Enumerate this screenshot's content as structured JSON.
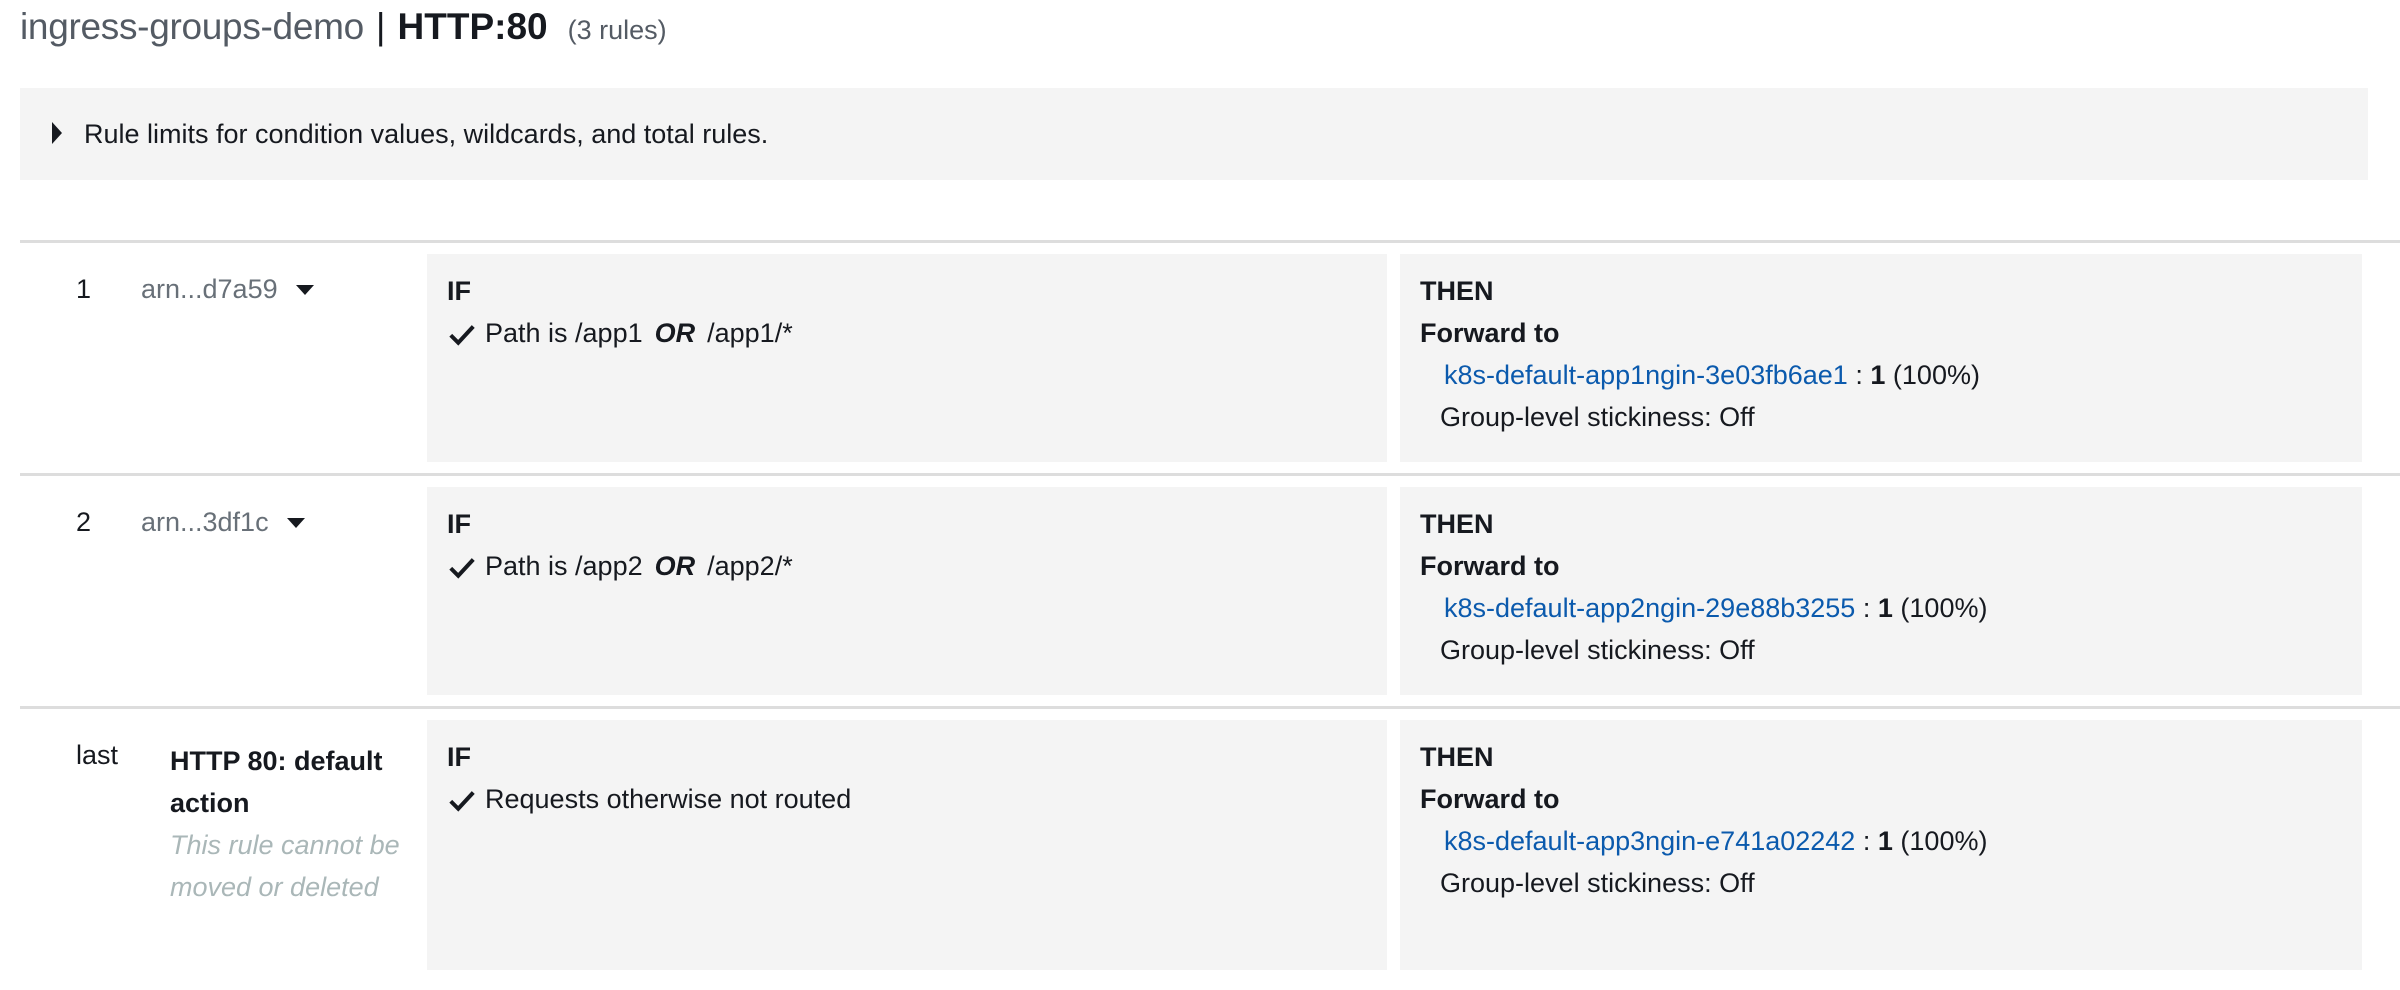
{
  "header": {
    "load_balancer": "ingress-groups-demo",
    "separator": "|",
    "listener": "HTTP:80",
    "rule_count": "(3 rules)"
  },
  "limits": {
    "label": "Rule limits for condition values, wildcards, and total rules.",
    "icon": "caret-right-icon"
  },
  "rules": [
    {
      "number": "1",
      "arn": "arn...d7a59",
      "if_label": "IF",
      "condition_prefix": "Path is /app1",
      "condition_or": "OR",
      "condition_suffix": "/app1/*",
      "then_label": "THEN",
      "action": "Forward to",
      "target_group": "k8s-default-app1ngin-3e03fb6ae1",
      "separator": ":",
      "weight": "1",
      "percent": "(100%)",
      "stickiness": "Group-level stickiness: Off"
    },
    {
      "number": "2",
      "arn": "arn...3df1c",
      "if_label": "IF",
      "condition_prefix": "Path is /app2",
      "condition_or": "OR",
      "condition_suffix": "/app2/*",
      "then_label": "THEN",
      "action": "Forward to",
      "target_group": "k8s-default-app2ngin-29e88b3255",
      "separator": ":",
      "weight": "1",
      "percent": "(100%)",
      "stickiness": "Group-level stickiness: Off"
    },
    {
      "number": "last",
      "default_title": "HTTP 80: default action",
      "default_note": "This rule cannot be moved or deleted",
      "if_label": "IF",
      "condition": "Requests otherwise not routed",
      "then_label": "THEN",
      "action": "Forward to",
      "target_group": "k8s-default-app3ngin-e741a02242",
      "separator": ":",
      "weight": "1",
      "percent": "(100%)",
      "stickiness": "Group-level stickiness: Off"
    }
  ],
  "colors": {
    "link": "#0b5aad",
    "panel": "#f4f4f4",
    "muted_text": "#687078",
    "note_text": "#aab7b8"
  }
}
